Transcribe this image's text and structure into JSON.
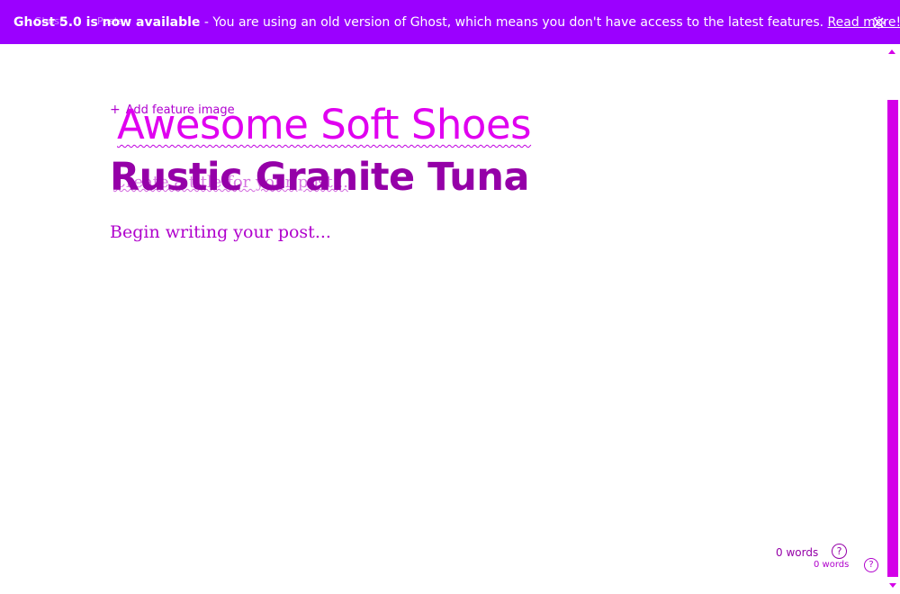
{
  "banner": {
    "headline": "Ghost 5.0 is now available",
    "message": " - You are using an old version of Ghost, which means you don't have access to the latest features. ",
    "link_label": "Read more!",
    "ghost_text_1": "Ghost",
    "ghost_text_2": "Posts",
    "close_icon": "close-icon",
    "background_color": "#9b00ff"
  },
  "editor": {
    "feature_image_label": "Add feature image",
    "title_overlay": "Awesome Soft Shoes",
    "title": "Rustic Granite Tuna",
    "excerpt_placeholder": "Create a title for your post...",
    "body_placeholder": "Begin writing your post..."
  },
  "footer": {
    "word_count_primary": "0 words",
    "word_count_secondary": "0 words",
    "help_label": "?",
    "help_label_2": "?"
  },
  "colors": {
    "accent": "#9b00ff",
    "title_overlay": "#e000f0",
    "title": "#9500a8",
    "scrollbar": "#d400e8"
  }
}
